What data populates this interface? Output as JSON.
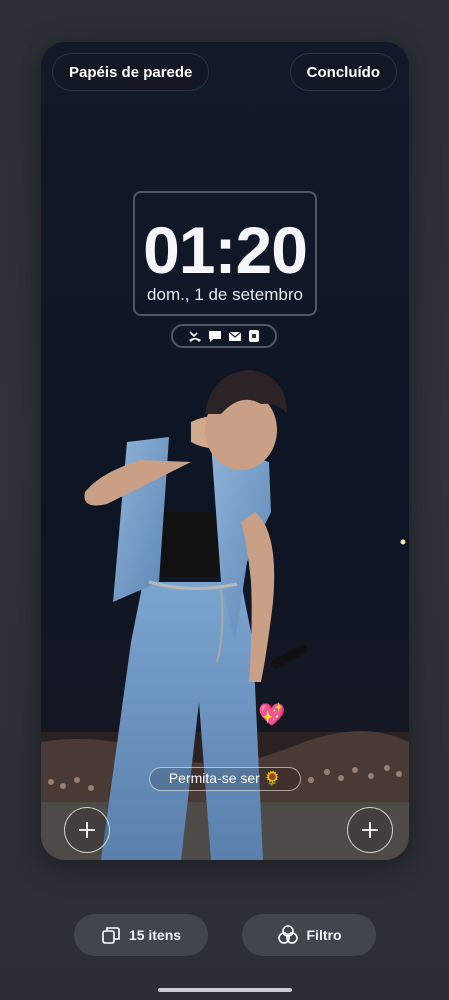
{
  "header": {
    "wallpapers_label": "Papéis de parede",
    "done_label": "Concluído"
  },
  "lockscreen": {
    "time": "01:20",
    "date": "dom., 1 de setembro",
    "notification_icons": [
      "missed-call-icon",
      "message-icon",
      "mail-icon",
      "lock-icon"
    ],
    "caption": "Permita-se ser 🌻",
    "sticker": "💖",
    "shortcuts": [
      "add-shortcut-left",
      "add-shortcut-right"
    ]
  },
  "bottom_bar": {
    "items_label": "15 itens",
    "filter_label": "Filtro"
  }
}
